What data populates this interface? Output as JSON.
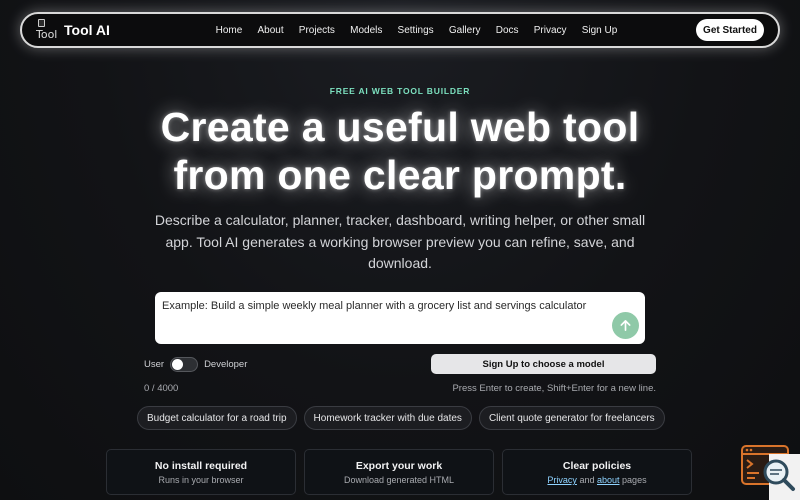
{
  "nav": {
    "brand_alt": "Tool",
    "brand_name": "Tool AI",
    "links": [
      "Home",
      "About",
      "Projects",
      "Models",
      "Settings",
      "Gallery",
      "Docs",
      "Privacy",
      "Sign Up"
    ],
    "cta": "Get Started"
  },
  "hero": {
    "eyebrow": "FREE AI WEB TOOL BUILDER",
    "headline_line1": "Create a useful web tool",
    "headline_line2": "from one clear prompt.",
    "subtext": "Describe a calculator, planner, tracker, dashboard, writing helper, or other small app. Tool AI generates a working browser preview you can refine, save, and download."
  },
  "prompt": {
    "placeholder": "Example: Build a simple weekly meal planner with a grocery list and servings calculator",
    "submit_icon": "arrow-up-icon"
  },
  "controls": {
    "mode_left": "User",
    "mode_right": "Developer",
    "model_button": "Sign Up to choose a model",
    "counter": "0 / 4000",
    "hint": "Press Enter to create, Shift+Enter for a new line."
  },
  "chips": [
    "Budget calculator for a road trip",
    "Homework tracker with due dates",
    "Client quote generator for freelancers"
  ],
  "cards": [
    {
      "title": "No install required",
      "sub": "Runs in your browser"
    },
    {
      "title": "Export your work",
      "sub": "Download generated HTML"
    },
    {
      "title": "Clear policies",
      "sub_link1": "Privacy",
      "sub_mid": "and",
      "sub_link2": "about",
      "sub_end": "pages"
    }
  ],
  "colors": {
    "accent": "#7ce0bf",
    "submit": "#8fc9a8",
    "link": "#8fd3ff",
    "corner_widget": "#d9742b"
  }
}
